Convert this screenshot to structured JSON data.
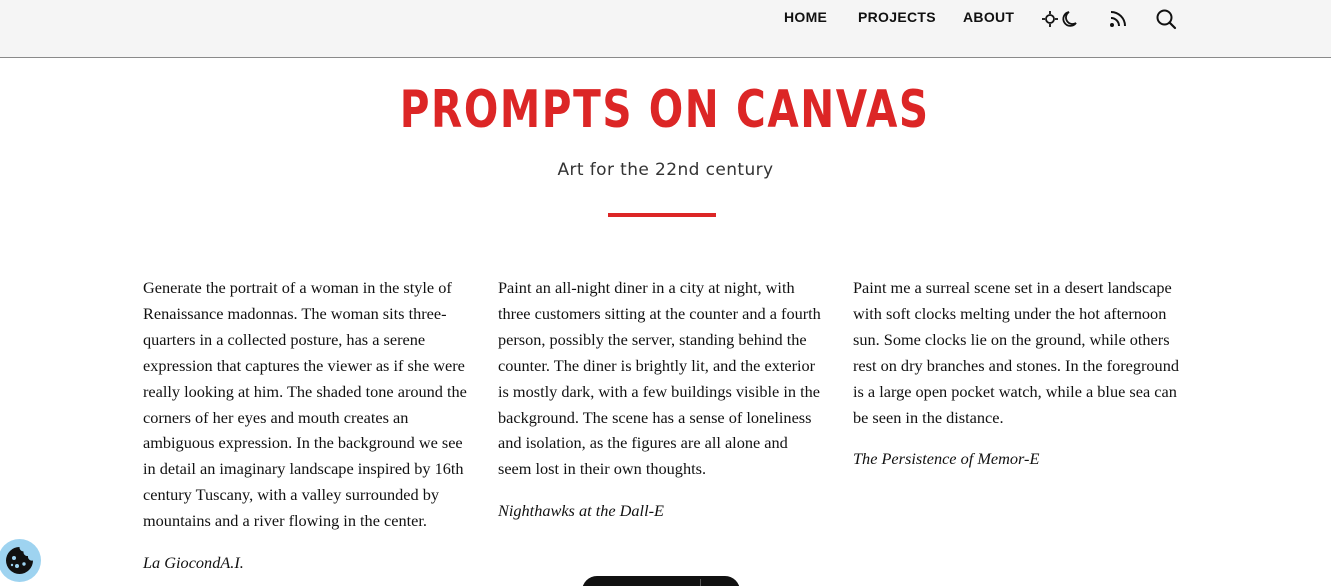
{
  "nav": {
    "links": [
      "HOME",
      "PROJECTS",
      "ABOUT"
    ],
    "icons": [
      "theme-toggle-icon",
      "rss-icon",
      "search-icon"
    ]
  },
  "header": {
    "title": "PROMPTS ON CANVAS",
    "subtitle": "Art for the 22nd century"
  },
  "colors": {
    "accent": "#dc2626",
    "topbar": "#f5f5f5",
    "cookie": "#9ed3f0"
  },
  "cards": [
    {
      "prompt": "Generate the portrait of a woman in the style of Renaissance madonnas. The woman sits three-quarters in a collected posture, has a serene expression that captures the viewer as if she were really looking at him. The shaded tone around the corners of her eyes and mouth creates an ambiguous expression. In the background we see in detail an imaginary landscape inspired by 16th century Tuscany, with a valley surrounded by mountains and a river flowing in the center.",
      "title": "La GiocondA.I."
    },
    {
      "prompt": "Paint an all-night diner in a city at night, with three customers sitting at the counter and a fourth person, possibly the server, standing behind the counter. The diner is brightly lit, and the exterior is mostly dark, with a few buildings visible in the background. The scene has a sense of loneliness and isolation, as the figures are all alone and seem lost in their own thoughts.",
      "title": "Nighthawks at the Dall-E"
    },
    {
      "prompt": "Paint me a surreal scene set in a desert landscape with soft clocks melting under the hot afternoon sun. Some clocks lie on the ground, while others rest on dry branches and stones. In the foreground is a large open pocket watch, while a blue sea can be seen in the distance.",
      "title": "The Persistence of Memor-E"
    }
  ],
  "cookie_button": {
    "icon": "cookie-icon"
  }
}
